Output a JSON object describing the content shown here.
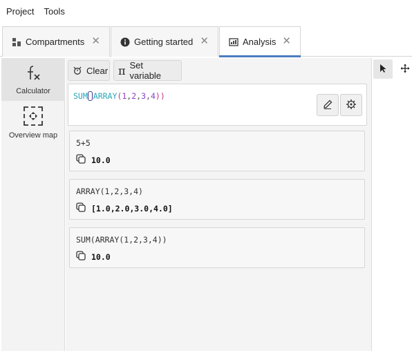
{
  "menu": [
    "Project",
    "Tools"
  ],
  "tabs": [
    {
      "label": "Compartments",
      "icon": "compartments-icon",
      "active": false
    },
    {
      "label": "Getting started",
      "icon": "info-icon",
      "active": false
    },
    {
      "label": "Analysis",
      "icon": "analysis-icon",
      "active": true
    }
  ],
  "sidebar": {
    "items": [
      {
        "label": "Calculator",
        "icon": "function-icon",
        "active": true
      },
      {
        "label": "Overview map",
        "icon": "overview-map-icon",
        "active": false
      }
    ]
  },
  "toolbar": {
    "clear_label": "Clear",
    "set_variable_label": "Set variable"
  },
  "editor": {
    "tokens": [
      "SUM",
      "(",
      "ARRAY",
      "(",
      "1",
      ",",
      "2",
      ",",
      "3",
      ",",
      "4",
      ")",
      ")"
    ]
  },
  "results": [
    {
      "expression": "5+5",
      "value": "10.0"
    },
    {
      "expression": "ARRAY(1,2,3,4)",
      "value": "[1.0,2.0,3.0,4.0]"
    },
    {
      "expression": "SUM(ARRAY(1,2,3,4))",
      "value": "10.0"
    }
  ],
  "colors": {
    "accent": "#4a7dbf",
    "function_token": "#2aa7b8",
    "paren_token": "#c0308f",
    "number_token": "#8a3fc4"
  }
}
